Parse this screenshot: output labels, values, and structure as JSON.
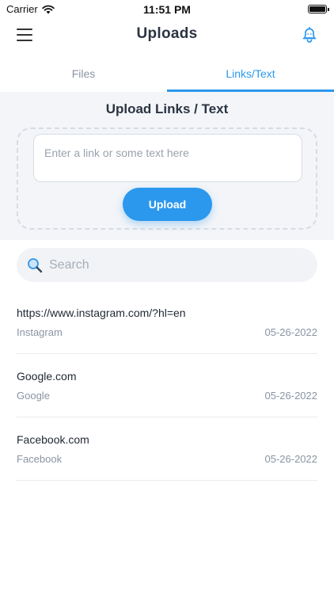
{
  "status_bar": {
    "carrier": "Carrier",
    "time": "11:51 PM",
    "battery_level": 1.0
  },
  "header": {
    "title": "Uploads",
    "menu_icon": "hamburger-menu-icon",
    "right_icon": "bell-icon"
  },
  "tabs": [
    {
      "label": "Files",
      "active": false
    },
    {
      "label": "Links/Text",
      "active": true
    }
  ],
  "upload": {
    "title": "Upload Links / Text",
    "input_placeholder": "Enter a link or some text here",
    "button_label": "Upload"
  },
  "search": {
    "placeholder": "Search"
  },
  "items": [
    {
      "title": "https://www.instagram.com/?hl=en",
      "source": "Instagram",
      "date": "05-26-2022"
    },
    {
      "title": "Google.com",
      "source": "Google",
      "date": "05-26-2022"
    },
    {
      "title": "Facebook.com",
      "source": "Facebook",
      "date": "05-26-2022"
    }
  ],
  "colors": {
    "accent": "#2b98ee",
    "panel_bg": "#f3f5f8",
    "text_primary": "#1f2733",
    "text_secondary": "#8a94a3"
  }
}
